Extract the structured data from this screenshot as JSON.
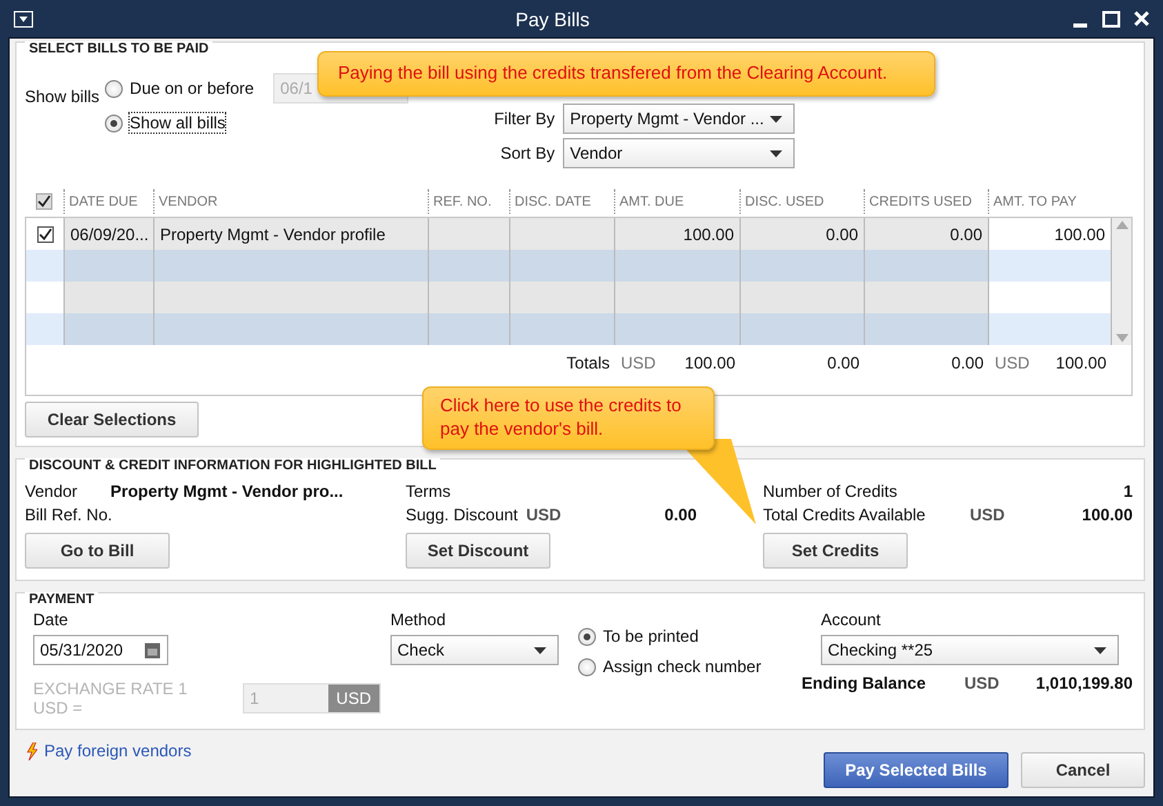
{
  "window": {
    "title": "Pay Bills"
  },
  "select_bills": {
    "heading": "SELECT BILLS TO BE PAID",
    "show_bills_label": "Show bills",
    "options": [
      {
        "label": "Due on or before",
        "selected": false
      },
      {
        "label": "Show all bills",
        "selected": true
      }
    ],
    "due_date": {
      "value": "06/1",
      "disabled": true
    },
    "filter_by": {
      "label": "Filter By",
      "value": "Property Mgmt - Vendor ..."
    },
    "sort_by": {
      "label": "Sort By",
      "value": "Vendor"
    }
  },
  "table": {
    "select_all_checked": true,
    "columns": [
      "DATE DUE",
      "VENDOR",
      "REF. NO.",
      "DISC. DATE",
      "AMT. DUE",
      "DISC. USED",
      "CREDITS USED",
      "AMT. TO PAY"
    ],
    "rows": [
      {
        "checked": true,
        "cells": [
          "06/09/20...",
          "Property Mgmt - Vendor profile",
          "",
          "",
          "100.00",
          "0.00",
          "0.00",
          "100.00"
        ]
      }
    ],
    "totals": {
      "label": "Totals",
      "currency": "USD",
      "amt_due": "100.00",
      "disc_used": "0.00",
      "credits_used": "0.00",
      "pay_currency": "USD",
      "amt_to_pay": "100.00"
    }
  },
  "clear_button": "Clear Selections",
  "discount": {
    "heading": "DISCOUNT & CREDIT INFORMATION FOR HIGHLIGHTED BILL",
    "vendor_label": "Vendor",
    "vendor_value": "Property Mgmt - Vendor pro...",
    "bill_ref_label": "Bill Ref. No.",
    "terms_label": "Terms",
    "sugg_discount_label": "Sugg. Discount",
    "sugg_currency": "USD",
    "sugg_value": "0.00",
    "credits_count_label": "Number of Credits",
    "credits_count": "1",
    "credits_total_label": "Total Credits Available",
    "credits_currency": "USD",
    "credits_total": "100.00",
    "buttons": [
      "Go to Bill",
      "Set Discount",
      "Set Credits"
    ]
  },
  "payment": {
    "heading": "PAYMENT",
    "date_label": "Date",
    "date_value": "05/31/2020",
    "exchange_label": "EXCHANGE RATE 1 USD =",
    "exchange_value": "1",
    "exchange_currency": "USD",
    "method_label": "Method",
    "method_value": "Check",
    "print_options": [
      {
        "label": "To be printed",
        "selected": true
      },
      {
        "label": "Assign check number",
        "selected": false
      }
    ],
    "account_label": "Account",
    "account_value": "Checking **25",
    "balance_label": "Ending Balance",
    "balance_currency": "USD",
    "balance_value": "1,010,199.80"
  },
  "foreign_link": "Pay foreign vendors",
  "actions": [
    {
      "label": "Pay Selected Bills",
      "primary": true
    },
    {
      "label": "Cancel",
      "primary": false
    }
  ],
  "callouts": [
    {
      "text": "Paying the bill using the credits transfered from the Clearing Account.",
      "kind": "banner"
    },
    {
      "text": "Click here to use the credits to pay the vendor's bill.",
      "kind": "pointer"
    }
  ]
}
